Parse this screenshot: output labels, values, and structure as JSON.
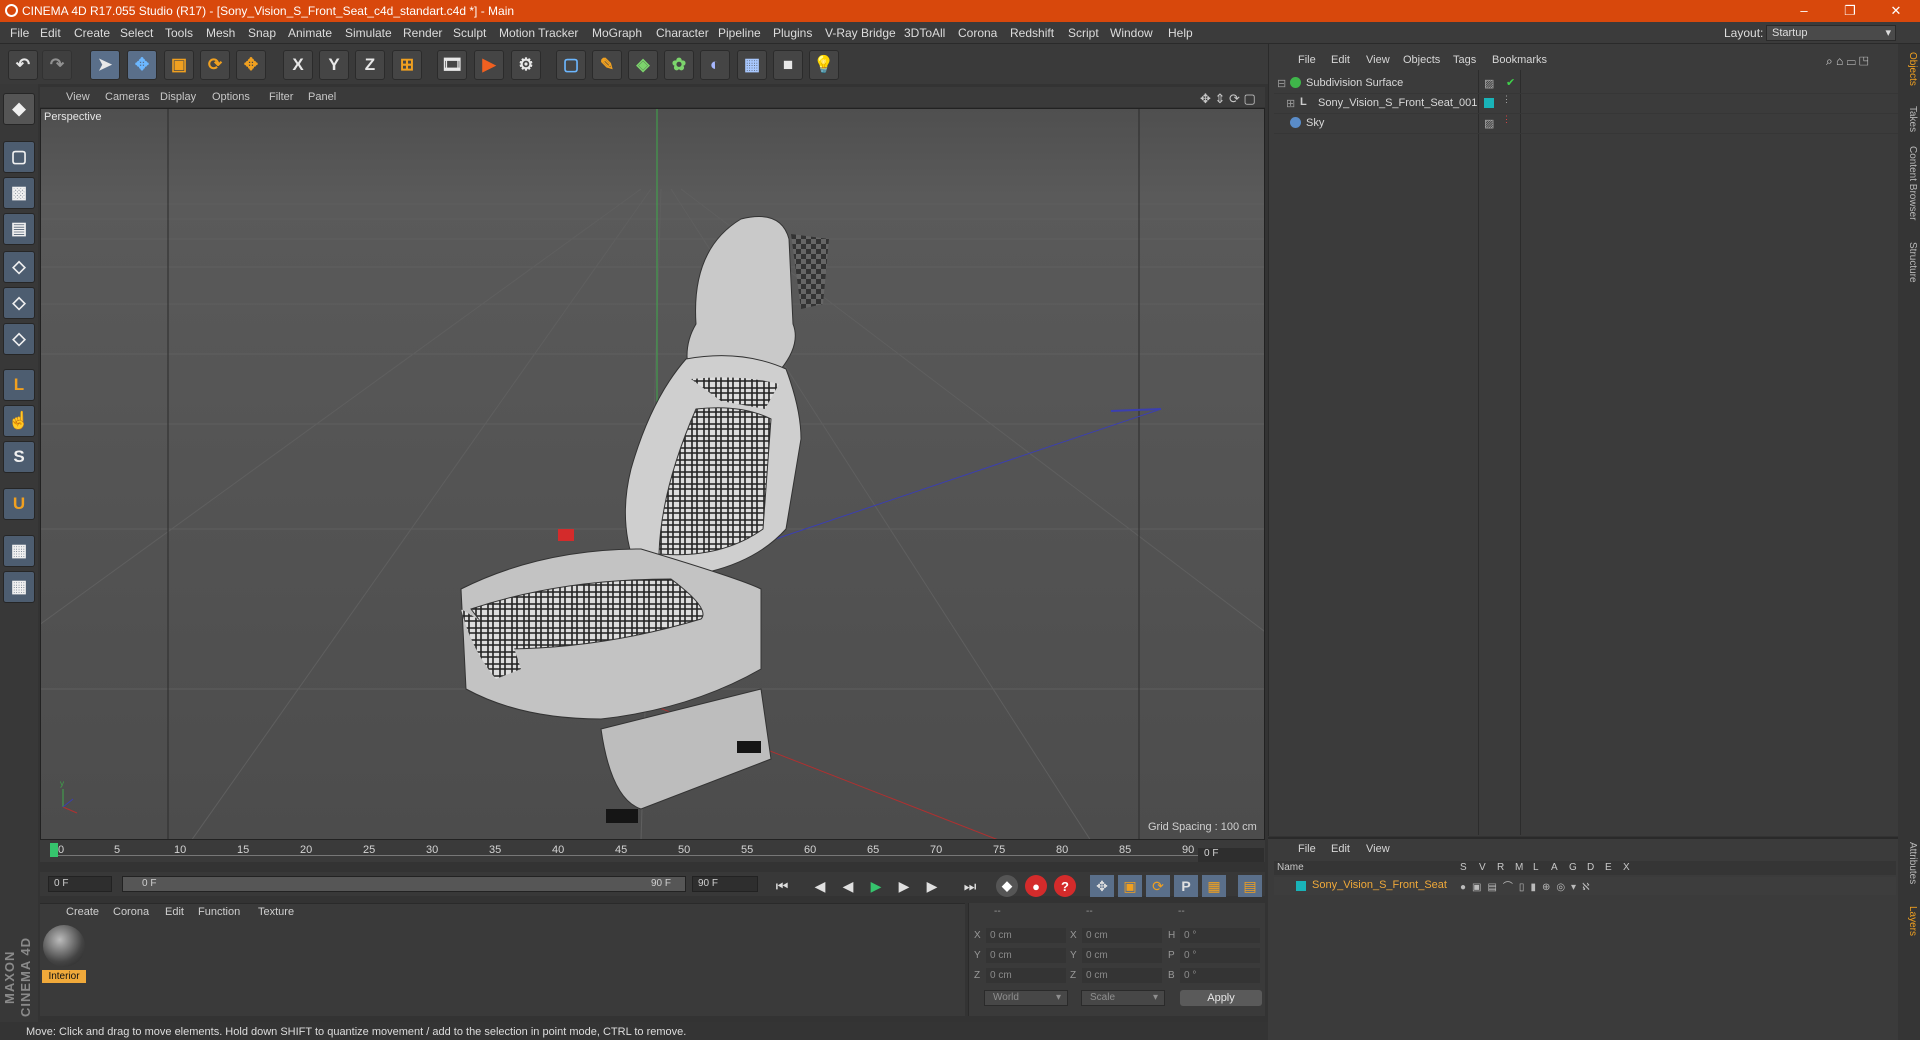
{
  "window": {
    "title": "CINEMA 4D R17.055 Studio (R17) - [Sony_Vision_S_Front_Seat_c4d_standart.c4d *] - Main",
    "minimize": "–",
    "restore": "❐",
    "close": "✕"
  },
  "menu": [
    "File",
    "Edit",
    "Create",
    "Select",
    "Tools",
    "Mesh",
    "Snap",
    "Animate",
    "Simulate",
    "Render",
    "Sculpt",
    "Motion Tracker",
    "MoGraph",
    "Character",
    "Pipeline",
    "Plugins",
    "V-Ray Bridge",
    "3DToAll",
    "Corona",
    "Redshift",
    "Script",
    "Window",
    "Help"
  ],
  "layout": {
    "label": "Layout:",
    "value": "Startup"
  },
  "viewport": {
    "menu": [
      "View",
      "Cameras",
      "Display",
      "Options",
      "Filter",
      "Panel"
    ],
    "label": "Perspective",
    "grid_spacing": "Grid Spacing : 100 cm"
  },
  "timeline": {
    "ticks": [
      "0",
      "5",
      "10",
      "15",
      "20",
      "25",
      "30",
      "35",
      "40",
      "45",
      "50",
      "55",
      "60",
      "65",
      "70",
      "75",
      "80",
      "85",
      "90"
    ],
    "current_frame": "0 F",
    "start": "0 F",
    "range_start": "0 F",
    "range_end": "90 F",
    "end": "90 F"
  },
  "material_manager": {
    "menu": [
      "Create",
      "Corona",
      "Edit",
      "Function",
      "Texture"
    ],
    "material_label": "Interior"
  },
  "coordinates": {
    "header": [
      "--",
      "--",
      "--"
    ],
    "rows": [
      {
        "axis": "X",
        "pos": "0 cm",
        "axis2": "X",
        "size": "0 cm",
        "axis3": "H",
        "rot": "0 °"
      },
      {
        "axis": "Y",
        "pos": "0 cm",
        "axis2": "Y",
        "size": "0 cm",
        "axis3": "P",
        "rot": "0 °"
      },
      {
        "axis": "Z",
        "pos": "0 cm",
        "axis2": "Z",
        "size": "0 cm",
        "axis3": "B",
        "rot": "0 °"
      }
    ],
    "mode": "World",
    "transform": "Scale",
    "apply": "Apply"
  },
  "status": "Move: Click and drag to move elements. Hold down SHIFT to quantize movement / add to the selection in point mode, CTRL to remove.",
  "object_manager": {
    "menu": [
      "File",
      "Edit",
      "View",
      "Objects",
      "Tags",
      "Bookmarks"
    ],
    "objects": [
      {
        "name": "Subdivision Surface",
        "icon_color": "#3fb54a"
      },
      {
        "name": "Sony_Vision_S_Front_Seat_001",
        "icon_color": "#c0c0c0"
      },
      {
        "name": "Sky",
        "icon_color": "#5a8cc8"
      }
    ]
  },
  "side_tabs": [
    "Objects",
    "Takes",
    "Content Browser",
    "Structure",
    "Attributes",
    "Layers"
  ],
  "layer_manager": {
    "menu": [
      "File",
      "Edit",
      "View"
    ],
    "columns": [
      "Name",
      "S",
      "V",
      "R",
      "M",
      "L",
      "A",
      "G",
      "D",
      "E",
      "X"
    ],
    "layer_name": "Sony_Vision_S_Front_Seat",
    "layer_color": "#19b3b8"
  },
  "colors": {
    "accent": "#d8480c",
    "selected_layer": "#f0a93a"
  },
  "icons": {
    "undo": "↶",
    "redo": "↷",
    "select": "➤",
    "move": "✥",
    "scale": "▣",
    "rotate": "⟳",
    "x": "X",
    "y": "Y",
    "z": "Z",
    "coords": "⊞",
    "render_view": "🎞",
    "render": "▶",
    "render_settings": "⚙",
    "cube": "▢",
    "pen": "✎",
    "subdiv": "◈",
    "cloner": "✿",
    "deformer": "◐",
    "floor": "▦",
    "camera": "■",
    "light": "💡",
    "model": "◆",
    "texture": "▩",
    "workplane": "▤",
    "point": "◇",
    "edge": "◇",
    "polygon": "◇",
    "axis": "L",
    "tweak": "☝",
    "snap": "S",
    "magnet": "U",
    "grid_lock": "▦",
    "grid_tool": "▦",
    "play": "▶",
    "prev": "◀",
    "next": "▶",
    "first": "⏮",
    "last": "⏭",
    "record": "●",
    "help": "?",
    "key": "◆"
  }
}
